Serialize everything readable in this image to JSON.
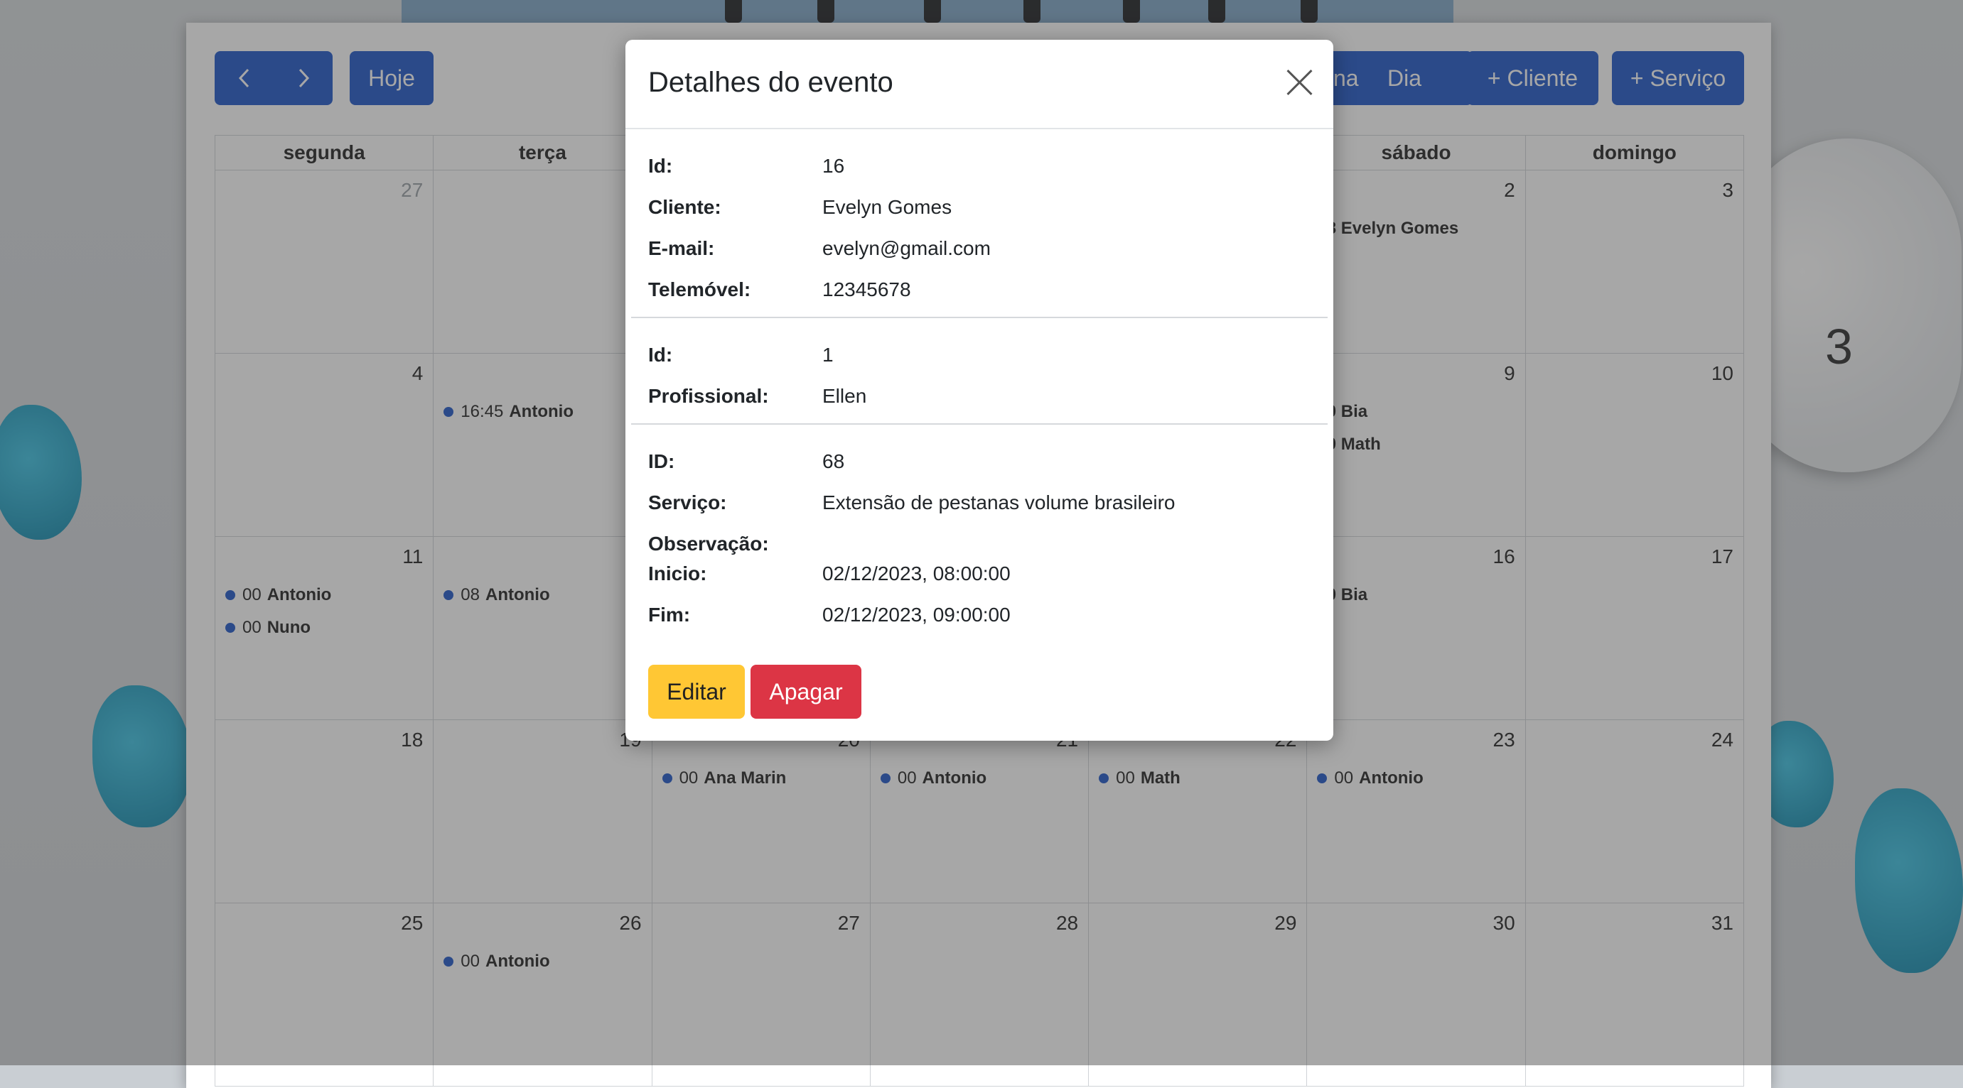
{
  "toolbar": {
    "prev_icon": "chevron-left-icon",
    "next_icon": "chevron-right-icon",
    "today_label": "Hoje",
    "view_week_partial": "na",
    "view_day_label": "Dia",
    "add_client_label": "+ Cliente",
    "add_service_label": "+ Serviço"
  },
  "calendar": {
    "weekdays": [
      "segunda",
      "terça",
      "",
      "",
      "",
      "sábado",
      "domingo"
    ],
    "weeks": [
      {
        "days": [
          "27",
          "",
          "",
          "",
          "",
          "2",
          "3"
        ]
      },
      {
        "days": [
          "4",
          "",
          "",
          "",
          "",
          "9",
          "10"
        ]
      },
      {
        "days": [
          "11",
          "",
          "",
          "",
          "",
          "16",
          "17"
        ]
      },
      {
        "days": [
          "18",
          "19",
          "20",
          "21",
          "22",
          "23",
          "24"
        ]
      },
      {
        "days": [
          "25",
          "26",
          "27",
          "28",
          "29",
          "30",
          "31"
        ]
      }
    ],
    "events": {
      "w0_sat": "08 Evelyn Gomes",
      "w1_tue": {
        "time": "16:45",
        "name": "Antonio"
      },
      "w1_sat_1": "00 Bia",
      "w1_sat_2": "00 Math",
      "w2_mon_1": {
        "time": "00",
        "name": "Antonio"
      },
      "w2_mon_2": {
        "time": "00",
        "name": "Nuno"
      },
      "w2_tue": {
        "time": "08",
        "name": "Antonio"
      },
      "w2_sat": "00 Bia",
      "w3_wed": {
        "time": "00",
        "name": "Ana Marin"
      },
      "w3_thu": {
        "time": "00",
        "name": "Antonio"
      },
      "w3_fri": {
        "time": "00",
        "name": "Math"
      },
      "w3_sat": {
        "time": "00",
        "name": "Antonio"
      },
      "w4_tue": {
        "time": "00",
        "name": "Antonio"
      }
    }
  },
  "modal": {
    "title": "Detalhes do evento",
    "close_icon": "close-icon",
    "client": [
      {
        "label": "Id:",
        "value": "16"
      },
      {
        "label": "Cliente:",
        "value": "Evelyn Gomes"
      },
      {
        "label": "E-mail:",
        "value": "evelyn@gmail.com"
      },
      {
        "label": "Telemóvel:",
        "value": "12345678"
      }
    ],
    "professional": [
      {
        "label": "Id:",
        "value": "1"
      },
      {
        "label": "Profissional:",
        "value": "Ellen"
      }
    ],
    "service": [
      {
        "label": "ID:",
        "value": "68"
      },
      {
        "label": "Serviço:",
        "value": "Extensão de pestanas volume brasileiro"
      },
      {
        "label": "Observação:",
        "value": ""
      },
      {
        "label": "Inicio:",
        "value": "02/12/2023, 08:00:00"
      },
      {
        "label": "Fim:",
        "value": "02/12/2023, 09:00:00"
      }
    ],
    "edit_label": "Editar",
    "delete_label": "Apagar"
  },
  "colors": {
    "primary": "#1e56c9",
    "warning": "#ffc734",
    "danger": "#dc3545"
  }
}
